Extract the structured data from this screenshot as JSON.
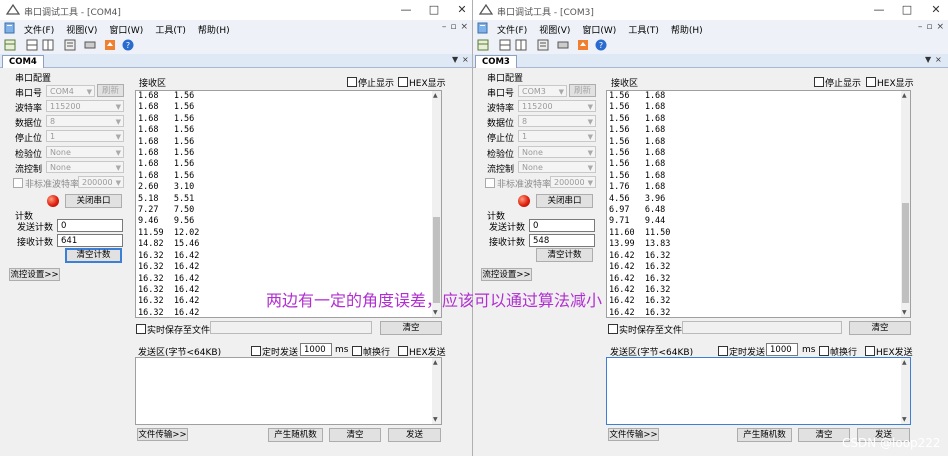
{
  "windows": [
    {
      "title": "串口调试工具 - [COM4]",
      "menu": [
        "文件(F)",
        "视图(V)",
        "窗口(W)",
        "工具(T)",
        "帮助(H)"
      ],
      "tab": "COM4",
      "serial_config": "串口配置",
      "port_label": "串口号",
      "port_value": "COM4",
      "refresh_button": "刷新",
      "baud_label": "波特率",
      "baud_value": "115200",
      "databits_label": "数据位",
      "databits_value": "8",
      "stopbits_label": "停止位",
      "stopbits_value": "1",
      "parity_label": "检验位",
      "parity_value": "None",
      "flow_label": "流控制",
      "flow_value": "None",
      "nonstd_label": "非标准波特率",
      "nonstd_value": "200000",
      "close_port_button": "关闭串口",
      "count_label": "计数",
      "sent_label": "发送计数",
      "sent_value": "0",
      "recv_label": "接收计数",
      "recv_value": "641",
      "clear_count_button": "清空计数",
      "flow_settings_button": "流控设置>>",
      "rx_label": "接收区",
      "stop_display": "停止显示",
      "hex_display": "HEX显示",
      "rx_lines": [
        "1.68   1.56",
        "1.68   1.56",
        "1.68   1.56",
        "1.68   1.56",
        "1.68   1.56",
        "1.68   1.56",
        "1.68   1.56",
        "1.68   1.56",
        "2.60   3.10",
        "5.18   5.51",
        "7.27   7.50",
        "9.46   9.56",
        "11.59  12.02",
        "14.82  15.46",
        "16.32  16.42",
        "16.32  16.42",
        "16.32  16.42",
        "16.32  16.42",
        "16.32  16.42",
        "16.32  16.42"
      ],
      "realtime_save": "实时保存至文件",
      "clear_button": "清空",
      "tx_label": "发送区(字节<64KB)",
      "timed_send": "定时发送",
      "interval_value": "1000",
      "ms": "ms",
      "newline": "帧换行",
      "hex_send": "HEX发送",
      "file_transfer_button": "文件传输>>",
      "random_button": "产生随机数",
      "clear_tx_button": "清空",
      "send_button": "发送"
    },
    {
      "title": "串口调试工具 - [COM3]",
      "menu": [
        "文件(F)",
        "视图(V)",
        "窗口(W)",
        "工具(T)",
        "帮助(H)"
      ],
      "tab": "COM3",
      "serial_config": "串口配置",
      "port_label": "串口号",
      "port_value": "COM3",
      "refresh_button": "刷新",
      "baud_label": "波特率",
      "baud_value": "115200",
      "databits_label": "数据位",
      "databits_value": "8",
      "stopbits_label": "停止位",
      "stopbits_value": "1",
      "parity_label": "检验位",
      "parity_value": "None",
      "flow_label": "流控制",
      "flow_value": "None",
      "nonstd_label": "非标准波特率",
      "nonstd_value": "200000",
      "close_port_button": "关闭串口",
      "count_label": "计数",
      "sent_label": "发送计数",
      "sent_value": "0",
      "recv_label": "接收计数",
      "recv_value": "548",
      "clear_count_button": "清空计数",
      "flow_settings_button": "流控设置>>",
      "rx_label": "接收区",
      "stop_display": "停止显示",
      "hex_display": "HEX显示",
      "rx_lines": [
        "1.56   1.68",
        "1.56   1.68",
        "1.56   1.68",
        "1.56   1.68",
        "1.56   1.68",
        "1.56   1.68",
        "1.56   1.68",
        "1.56   1.68",
        "1.76   1.68",
        "4.56   3.96",
        "6.97   6.48",
        "9.71   9.44",
        "11.60  11.50",
        "13.99  13.83",
        "16.42  16.32",
        "16.42  16.32",
        "16.42  16.32",
        "16.42  16.32",
        "16.42  16.32",
        "16.42  16.32"
      ],
      "realtime_save": "实时保存至文件",
      "clear_button": "清空",
      "tx_label": "发送区(字节<64KB)",
      "timed_send": "定时发送",
      "interval_value": "1000",
      "ms": "ms",
      "newline": "帧换行",
      "hex_send": "HEX发送",
      "file_transfer_button": "文件传输>>",
      "random_button": "产生随机数",
      "clear_tx_button": "清空",
      "send_button": "发送"
    }
  ],
  "annotation": "两边有一定的角度误差，应该可以通过算法减小",
  "watermark": "CSDN @loop222"
}
